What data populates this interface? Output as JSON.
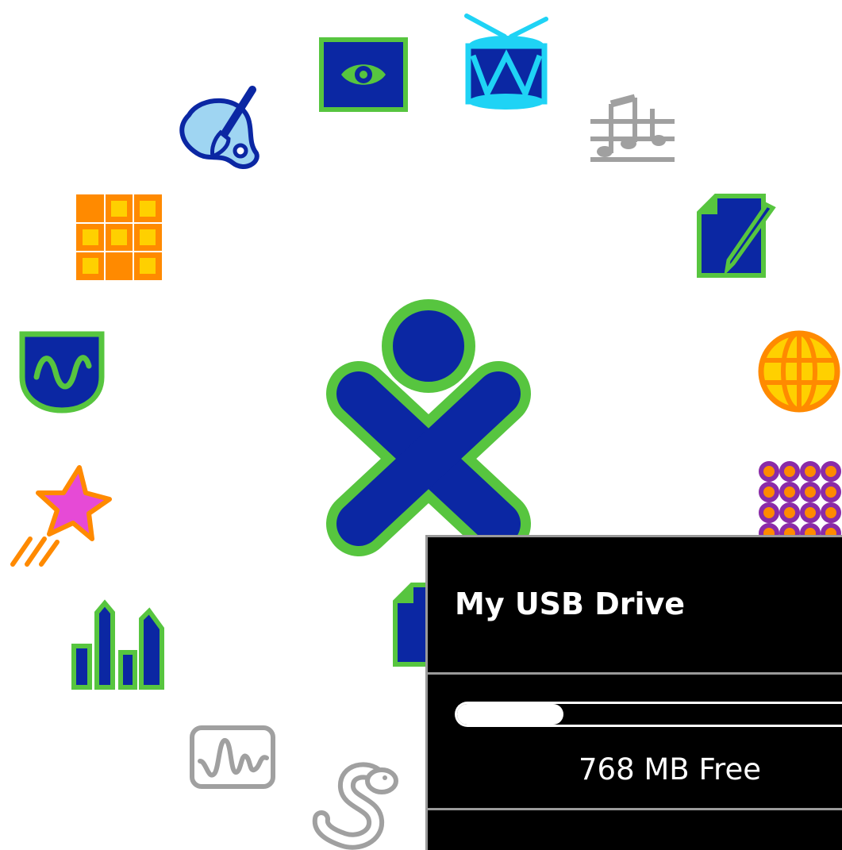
{
  "colors": {
    "xo_stroke": "#57c53f",
    "xo_fill": "#0b27a3",
    "activity_inactive": "#a0a0a0",
    "palette_bg": "#000000",
    "palette_text": "#ffffff",
    "palette_separator": "#9a9a9a"
  },
  "ring_icons": [
    {
      "name": "browse-activity-icon"
    },
    {
      "name": "view-slides-activity-icon"
    },
    {
      "name": "tamtam-drum-activity-icon"
    },
    {
      "name": "tamtam-music-activity-icon"
    },
    {
      "name": "write-activity-icon"
    },
    {
      "name": "web-globe-activity-icon"
    },
    {
      "name": "memorize-grid-activity-icon"
    },
    {
      "name": "paint-activity-icon"
    },
    {
      "name": "calculate-grid-activity-icon"
    },
    {
      "name": "measure-activity-icon"
    },
    {
      "name": "star-activity-icon"
    },
    {
      "name": "chart-activity-icon"
    },
    {
      "name": "waveform-activity-icon"
    },
    {
      "name": "pippy-snake-activity-icon"
    },
    {
      "name": "journal-document-icon"
    }
  ],
  "usb_palette": {
    "title": "My USB Drive",
    "free_space_label": "768 MB Free",
    "used_fraction": 0.26
  }
}
